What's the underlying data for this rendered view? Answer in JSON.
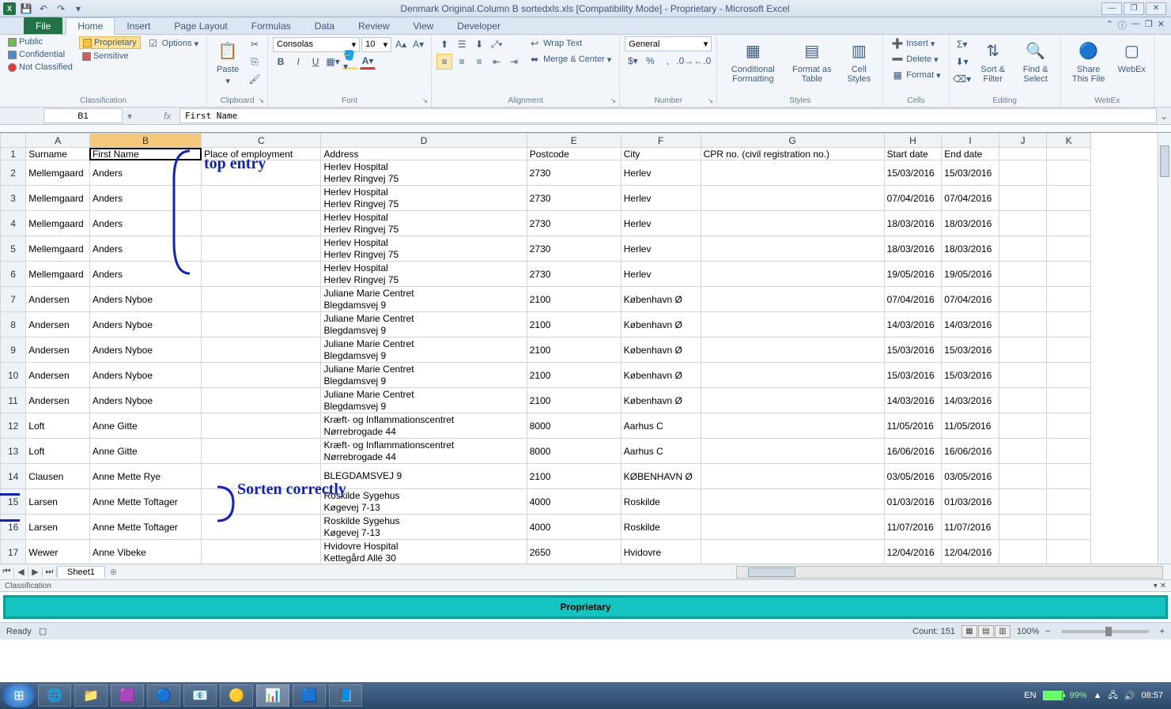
{
  "window": {
    "title": "Denmark Original.Column B sortedxls.xls  [Compatibility Mode]  -  Proprietary  -  Microsoft Excel"
  },
  "ribbon": {
    "tabs": [
      "File",
      "Home",
      "Insert",
      "Page Layout",
      "Formulas",
      "Data",
      "Review",
      "View",
      "Developer"
    ],
    "active_tab": "Home",
    "classification": {
      "public": "Public",
      "confidential": "Confidential",
      "not_classified": "Not Classified",
      "proprietary": "Proprietary",
      "sensitive": "Sensitive",
      "options": "Options",
      "group": "Classification"
    },
    "clipboard": {
      "paste": "Paste",
      "group": "Clipboard"
    },
    "font": {
      "name": "Consolas",
      "size": "10",
      "group": "Font",
      "bold": "B",
      "italic": "I",
      "underline": "U"
    },
    "alignment": {
      "wrap": "Wrap Text",
      "merge": "Merge & Center",
      "group": "Alignment"
    },
    "number": {
      "format": "General",
      "group": "Number"
    },
    "styles": {
      "cond": "Conditional Formatting",
      "table": "Format as Table",
      "cell": "Cell Styles",
      "group": "Styles"
    },
    "cells": {
      "insert": "Insert",
      "delete": "Delete",
      "format": "Format",
      "group": "Cells"
    },
    "editing": {
      "sort": "Sort & Filter",
      "find": "Find & Select",
      "group": "Editing"
    },
    "webex": {
      "share": "Share This File",
      "webex": "WebEx",
      "group": "WebEx"
    }
  },
  "formula_bar": {
    "name_box": "B1",
    "formula": "First Name"
  },
  "columns": [
    "",
    "A",
    "B",
    "C",
    "D",
    "E",
    "F",
    "G",
    "H",
    "I",
    "J",
    "K"
  ],
  "headers": {
    "A": "Surname",
    "B": "First Name",
    "C": "Place of employment",
    "D": "Address",
    "E": "Postcode",
    "F": "City",
    "G": "CPR no. (civil registration no.)",
    "H": "Start date",
    "I": "End date"
  },
  "rows": [
    {
      "n": 2,
      "A": "Mellemgaard",
      "B": "Anders",
      "D": "Herlev Hospital\nHerlev Ringvej 75",
      "E": "2730",
      "F": "Herlev",
      "H": "15/03/2016",
      "I": "15/03/2016"
    },
    {
      "n": 3,
      "A": "Mellemgaard",
      "B": "Anders",
      "D": "Herlev Hospital\nHerlev Ringvej 75",
      "E": "2730",
      "F": "Herlev",
      "H": "07/04/2016",
      "I": "07/04/2016"
    },
    {
      "n": 4,
      "A": "Mellemgaard",
      "B": "Anders",
      "D": "Herlev Hospital\nHerlev Ringvej 75",
      "E": "2730",
      "F": "Herlev",
      "H": "18/03/2016",
      "I": "18/03/2016"
    },
    {
      "n": 5,
      "A": "Mellemgaard",
      "B": "Anders",
      "D": "Herlev Hospital\nHerlev Ringvej 75",
      "E": "2730",
      "F": "Herlev",
      "H": "18/03/2016",
      "I": "18/03/2016"
    },
    {
      "n": 6,
      "A": "Mellemgaard",
      "B": "Anders",
      "D": "Herlev Hospital\nHerlev Ringvej 75",
      "E": "2730",
      "F": "Herlev",
      "H": "19/05/2016",
      "I": "19/05/2016"
    },
    {
      "n": 7,
      "A": "Andersen",
      "B": "Anders Nyboe",
      "D": "Juliane Marie Centret\nBlegdamsvej 9",
      "E": "2100",
      "F": "København Ø",
      "H": "07/04/2016",
      "I": "07/04/2016"
    },
    {
      "n": 8,
      "A": "Andersen",
      "B": "Anders Nyboe",
      "D": "Juliane Marie Centret\nBlegdamsvej 9",
      "E": "2100",
      "F": "København Ø",
      "H": "14/03/2016",
      "I": "14/03/2016"
    },
    {
      "n": 9,
      "A": "Andersen",
      "B": "Anders Nyboe",
      "D": "Juliane Marie Centret\nBlegdamsvej 9",
      "E": "2100",
      "F": "København Ø",
      "H": "15/03/2016",
      "I": "15/03/2016"
    },
    {
      "n": 10,
      "A": "Andersen",
      "B": "Anders Nyboe",
      "D": "Juliane Marie Centret\nBlegdamsvej 9",
      "E": "2100",
      "F": "København Ø",
      "H": "15/03/2016",
      "I": "15/03/2016"
    },
    {
      "n": 11,
      "A": "Andersen",
      "B": "Anders Nyboe",
      "D": "Juliane Marie Centret\nBlegdamsvej 9",
      "E": "2100",
      "F": "København Ø",
      "H": "14/03/2016",
      "I": "14/03/2016"
    },
    {
      "n": 12,
      "A": "Loft",
      "B": "Anne Gitte",
      "D": "Kræft- og Inflammationscentret\nNørrebrogade 44",
      "E": "8000",
      "F": "Aarhus C",
      "H": "11/05/2016",
      "I": "11/05/2016"
    },
    {
      "n": 13,
      "A": "Loft",
      "B": "Anne Gitte",
      "D": "Kræft- og Inflammationscentret\nNørrebrogade 44",
      "E": "8000",
      "F": "Aarhus C",
      "H": "16/06/2016",
      "I": "16/06/2016"
    },
    {
      "n": 14,
      "A": "Clausen",
      "B": "Anne Mette Rye",
      "D": "BLEGDAMSVEJ 9\n",
      "E": "2100",
      "F": "KØBENHAVN Ø",
      "H": "03/05/2016",
      "I": "03/05/2016"
    },
    {
      "n": 15,
      "A": "Larsen",
      "B": "Anne Mette Toftager",
      "D": "Roskilde Sygehus\nKøgevej 7-13",
      "E": "4000",
      "F": "Roskilde",
      "H": "01/03/2016",
      "I": "01/03/2016"
    },
    {
      "n": 16,
      "A": "Larsen",
      "B": "Anne Mette Toftager",
      "D": "Roskilde Sygehus\nKøgevej 7-13",
      "E": "4000",
      "F": "Roskilde",
      "H": "11/07/2016",
      "I": "11/07/2016"
    },
    {
      "n": 17,
      "A": "Wewer",
      "B": "Anne Vibeke",
      "D": "Hvidovre Hospital\nKettegård Allé 30",
      "E": "2650",
      "F": "Hvidovre",
      "H": "12/04/2016",
      "I": "12/04/2016"
    }
  ],
  "annotations": {
    "top_entry": "top entry",
    "sorted": "Sorten correctly"
  },
  "sheet": {
    "active": "Sheet1"
  },
  "classification_bar": {
    "label": "Classification",
    "banner": "Proprietary"
  },
  "status": {
    "ready": "Ready",
    "count": "Count: 151",
    "zoom": "100%"
  },
  "tray": {
    "lang": "EN",
    "battery": "99%",
    "clock": "08:57"
  }
}
